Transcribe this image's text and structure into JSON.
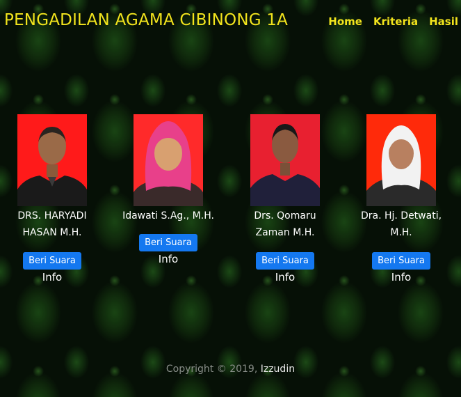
{
  "header": {
    "title": "PENGADILAN AGAMA CIBINONG 1A",
    "nav": [
      "Home",
      "Kriteria",
      "Hasil"
    ]
  },
  "candidates": [
    {
      "name_line1": "DRS. HARYADI",
      "name_line2": "HASAN M.H.",
      "vote_label": "Beri Suara",
      "info_label": "Info",
      "bg_color": "#ff1a1a"
    },
    {
      "name_line1": "Idawati S.Ag., M.H.",
      "name_line2": "",
      "vote_label": "Beri Suara",
      "info_label": "Info",
      "bg_color": "#ff2a2a"
    },
    {
      "name_line1": "Drs. Qomaru",
      "name_line2": "Zaman M.H.",
      "vote_label": "Beri Suara",
      "info_label": "Info",
      "bg_color": "#e82030"
    },
    {
      "name_line1": "Dra. Hj. Detwati,",
      "name_line2": "M.H.",
      "vote_label": "Beri Suara",
      "info_label": "Info",
      "bg_color": "#ff2a0a"
    }
  ],
  "footer": {
    "copyright": "Copyright © 2019,",
    "author": "Izzudin"
  }
}
